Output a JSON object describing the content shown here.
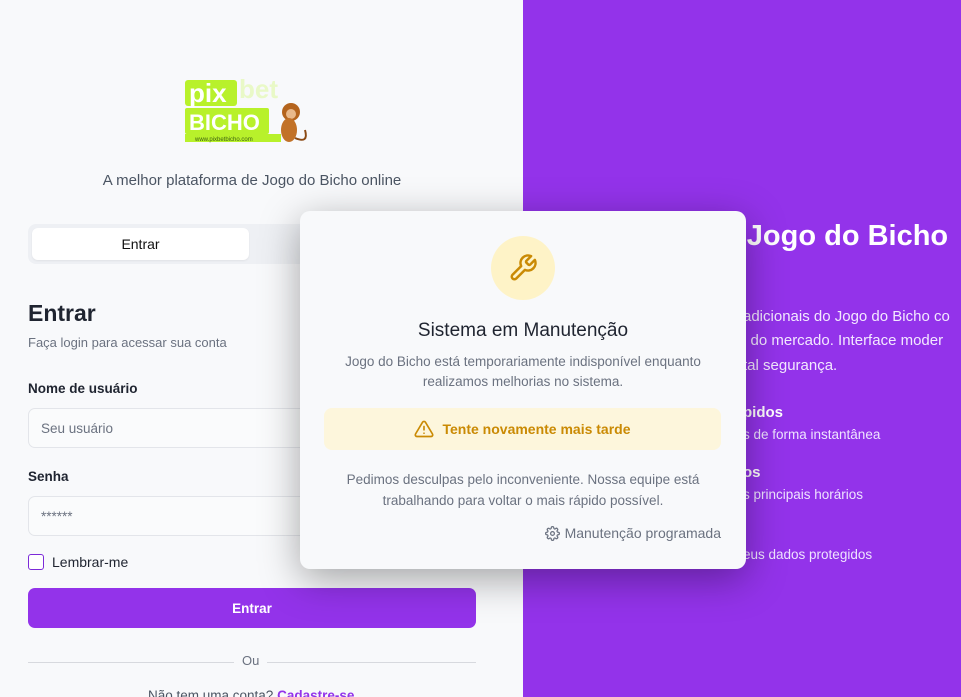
{
  "brand": {
    "logo_text_pix": "pix",
    "logo_text_bet": "bet",
    "logo_text_bicho": "BICHO",
    "logo_url": "www.pixbetbicho.com",
    "tagline": "A melhor plataforma de Jogo do Bicho online"
  },
  "tabs": {
    "login": "Entrar",
    "register": ""
  },
  "form": {
    "title": "Entrar",
    "subtitle": "Faça login para acessar sua conta",
    "username_label": "Nome de usuário",
    "username_placeholder": "Seu usuário",
    "password_label": "Senha",
    "password_placeholder": "******",
    "remember_label": "Lembrar-me",
    "submit_label": "Entrar",
    "divider_text": "Ou",
    "signup_prompt": "Não tem uma conta?",
    "signup_link": "Cadastre-se"
  },
  "promo": {
    "title": "o Jogo do Bicho",
    "text_line1": "adicionais do Jogo do Bicho co",
    "text_line2": "l do mercado. Interface moder",
    "text_line3": "tal segurança.",
    "features": [
      {
        "title": "pidos",
        "desc": "s de forma instantânea"
      },
      {
        "title": "os",
        "desc": "s principais horários"
      },
      {
        "title": "",
        "desc": "eus dados protegidos"
      }
    ]
  },
  "modal": {
    "icon": "wrench-icon",
    "title": "Sistema em Manutenção",
    "text": "Jogo do Bicho está temporariamente indisponível enquanto realizamos melhorias no sistema.",
    "alert": "Tente novamente mais tarde",
    "apology": "Pedimos desculpas pelo inconveniente. Nossa equipe está trabalhando para voltar o mais rápido possível.",
    "footer": "Manutenção programada"
  },
  "colors": {
    "primary": "#9333ea",
    "warning": "#ca8a04",
    "warning_bg": "#fdf6dc",
    "logo_green": "#b8f12b"
  }
}
